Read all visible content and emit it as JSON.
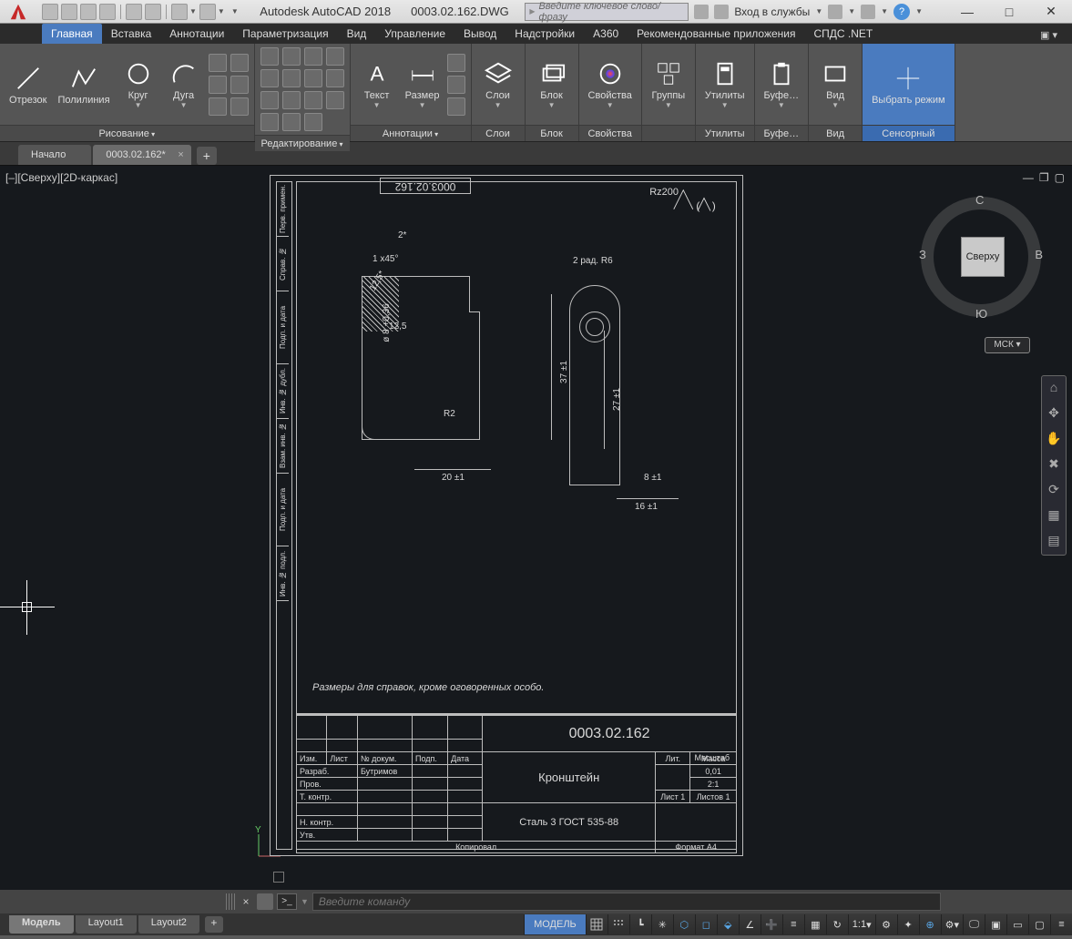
{
  "app": {
    "title_app": "Autodesk AutoCAD 2018",
    "title_doc": "0003.02.162.DWG",
    "search_placeholder": "Введите ключевое слово/фразу",
    "login_label": "Вход в службы",
    "help": "?"
  },
  "window_buttons": {
    "min": "—",
    "max": "□",
    "close": "✕"
  },
  "menu_tabs": [
    "Главная",
    "Вставка",
    "Аннотации",
    "Параметризация",
    "Вид",
    "Управление",
    "Вывод",
    "Надстройки",
    "A360",
    "Рекомендованные приложения",
    "СПДС .NET"
  ],
  "menu_active_index": 0,
  "ribbon": {
    "panels": [
      {
        "title": "Рисование",
        "dd": true,
        "items": [
          {
            "label": "Отрезок",
            "icon": "line-icon"
          },
          {
            "label": "Полилиния",
            "icon": "polyline-icon"
          },
          {
            "label": "Круг",
            "icon": "circle-icon",
            "dd": true
          },
          {
            "label": "Дуга",
            "icon": "arc-icon",
            "dd": true
          }
        ],
        "extra_grid_cols": 2,
        "extra_grid_rows": 3
      },
      {
        "title": "Редактирование",
        "dd": true,
        "grid_cols": 5,
        "grid_rows": 3
      },
      {
        "title": "Аннотации",
        "dd": true,
        "items": [
          {
            "label": "Текст",
            "icon": "text-icon",
            "dd": true
          },
          {
            "label": "Размер",
            "icon": "dimension-icon",
            "dd": true
          }
        ],
        "extra_grid_cols": 1,
        "extra_grid_rows": 3
      },
      {
        "title": "Слои",
        "items": [
          {
            "label": "Слои",
            "icon": "layers-icon",
            "dd": true
          }
        ]
      },
      {
        "title": "Блок",
        "items": [
          {
            "label": "Блок",
            "icon": "block-icon",
            "dd": true
          }
        ]
      },
      {
        "title": "Свойства",
        "items": [
          {
            "label": "Свойства",
            "icon": "properties-icon",
            "dd": true
          }
        ]
      },
      {
        "title": " ",
        "items": [
          {
            "label": "Группы",
            "icon": "groups-icon",
            "dd": true
          }
        ]
      },
      {
        "title": "Утилиты",
        "items": [
          {
            "label": "Утилиты",
            "icon": "utilities-icon",
            "dd": true
          }
        ]
      },
      {
        "title": "Буфе…",
        "items": [
          {
            "label": "Буфе…",
            "icon": "clipboard-icon",
            "dd": true
          }
        ]
      },
      {
        "title": "Вид",
        "items": [
          {
            "label": "Вид",
            "icon": "view-icon",
            "dd": true
          }
        ]
      },
      {
        "title": "Сенсорный",
        "touch": true,
        "items": [
          {
            "label": "Выбрать режим",
            "icon": "touch-icon"
          }
        ]
      }
    ]
  },
  "file_tabs": {
    "tabs": [
      {
        "label": "Начало",
        "active": false
      },
      {
        "label": "0003.02.162*",
        "active": true
      }
    ]
  },
  "viewport": {
    "label": "[–][Сверху][2D-каркас]",
    "controls": {
      "min": "—",
      "restore": "❐",
      "max": "▢"
    }
  },
  "viewcube": {
    "face": "Сверху",
    "n": "С",
    "s": "Ю",
    "e": "В",
    "w": "З",
    "wcs": "МСК ▾"
  },
  "nav_tools": [
    "⌂",
    "✥",
    "✋",
    "✖",
    "⟳",
    "▦",
    "▤"
  ],
  "ucs_label": "Y",
  "drawing": {
    "top_code": "0003.02.162",
    "surface": "Rz200",
    "dims": {
      "d1": "2*",
      "d2": "1 x45°",
      "d3": "12,5*",
      "d4": "12,5",
      "d5": "ø 8 +0,36",
      "d6": "R2",
      "d7": "20 ±1",
      "d8": "37 ±1",
      "d9": "2 рад. R6",
      "d10": "27 ±1",
      "d11": "8 ±1",
      "d12": "16 ±1"
    },
    "note": "Размеры для справок, кроме оговоренных особо.",
    "titleblock": {
      "drawing_no": "0003.02.162",
      "part_name": "Кронштейн",
      "material": "Сталь 3 ГОСТ 535-88",
      "rows": {
        "r_headers": [
          "Изм.",
          "Лист",
          "№ докум.",
          "Подп.",
          "Дата"
        ],
        "r_dev": "Разраб.",
        "r_dev_name": "Бутримов",
        "r_check": "Пров.",
        "r_tcontr": "Т. контр.",
        "r_ncontr": "Н. контр.",
        "r_appr": "Утв."
      },
      "right": {
        "lit": "Лит.",
        "mass": "Масса",
        "scale": "Масштаб",
        "mass_val": "0,01",
        "scale_val": "2:1",
        "sheet": "Лист 1",
        "sheets": "Листов 1",
        "copied": "Копировал",
        "format": "Формат А4"
      }
    },
    "side_cells": [
      "Инв. № подл.",
      "Подп. и дата",
      "Взам. инв. №",
      "Инв. № дубл.",
      "Подп. и дата",
      "Справ. №",
      "Перв. примен."
    ]
  },
  "command": {
    "prompt": ">_",
    "placeholder": "Введите команду"
  },
  "layout_tabs": [
    "Модель",
    "Layout1",
    "Layout2"
  ],
  "layout_active_index": 0,
  "status": {
    "model": "МОДЕЛЬ",
    "scale": "1:1",
    "buttons_right": [
      "grid",
      "snap",
      "ortho",
      "polar",
      "iso",
      "osnap",
      "otrack",
      "dyn",
      "lwt",
      "transp",
      "cycling",
      "3dosnap",
      "dducs",
      "sel",
      "gizmo",
      "ann-vis",
      "ann-auto",
      "ws",
      "mon",
      "hw",
      "clean",
      "custom"
    ]
  }
}
